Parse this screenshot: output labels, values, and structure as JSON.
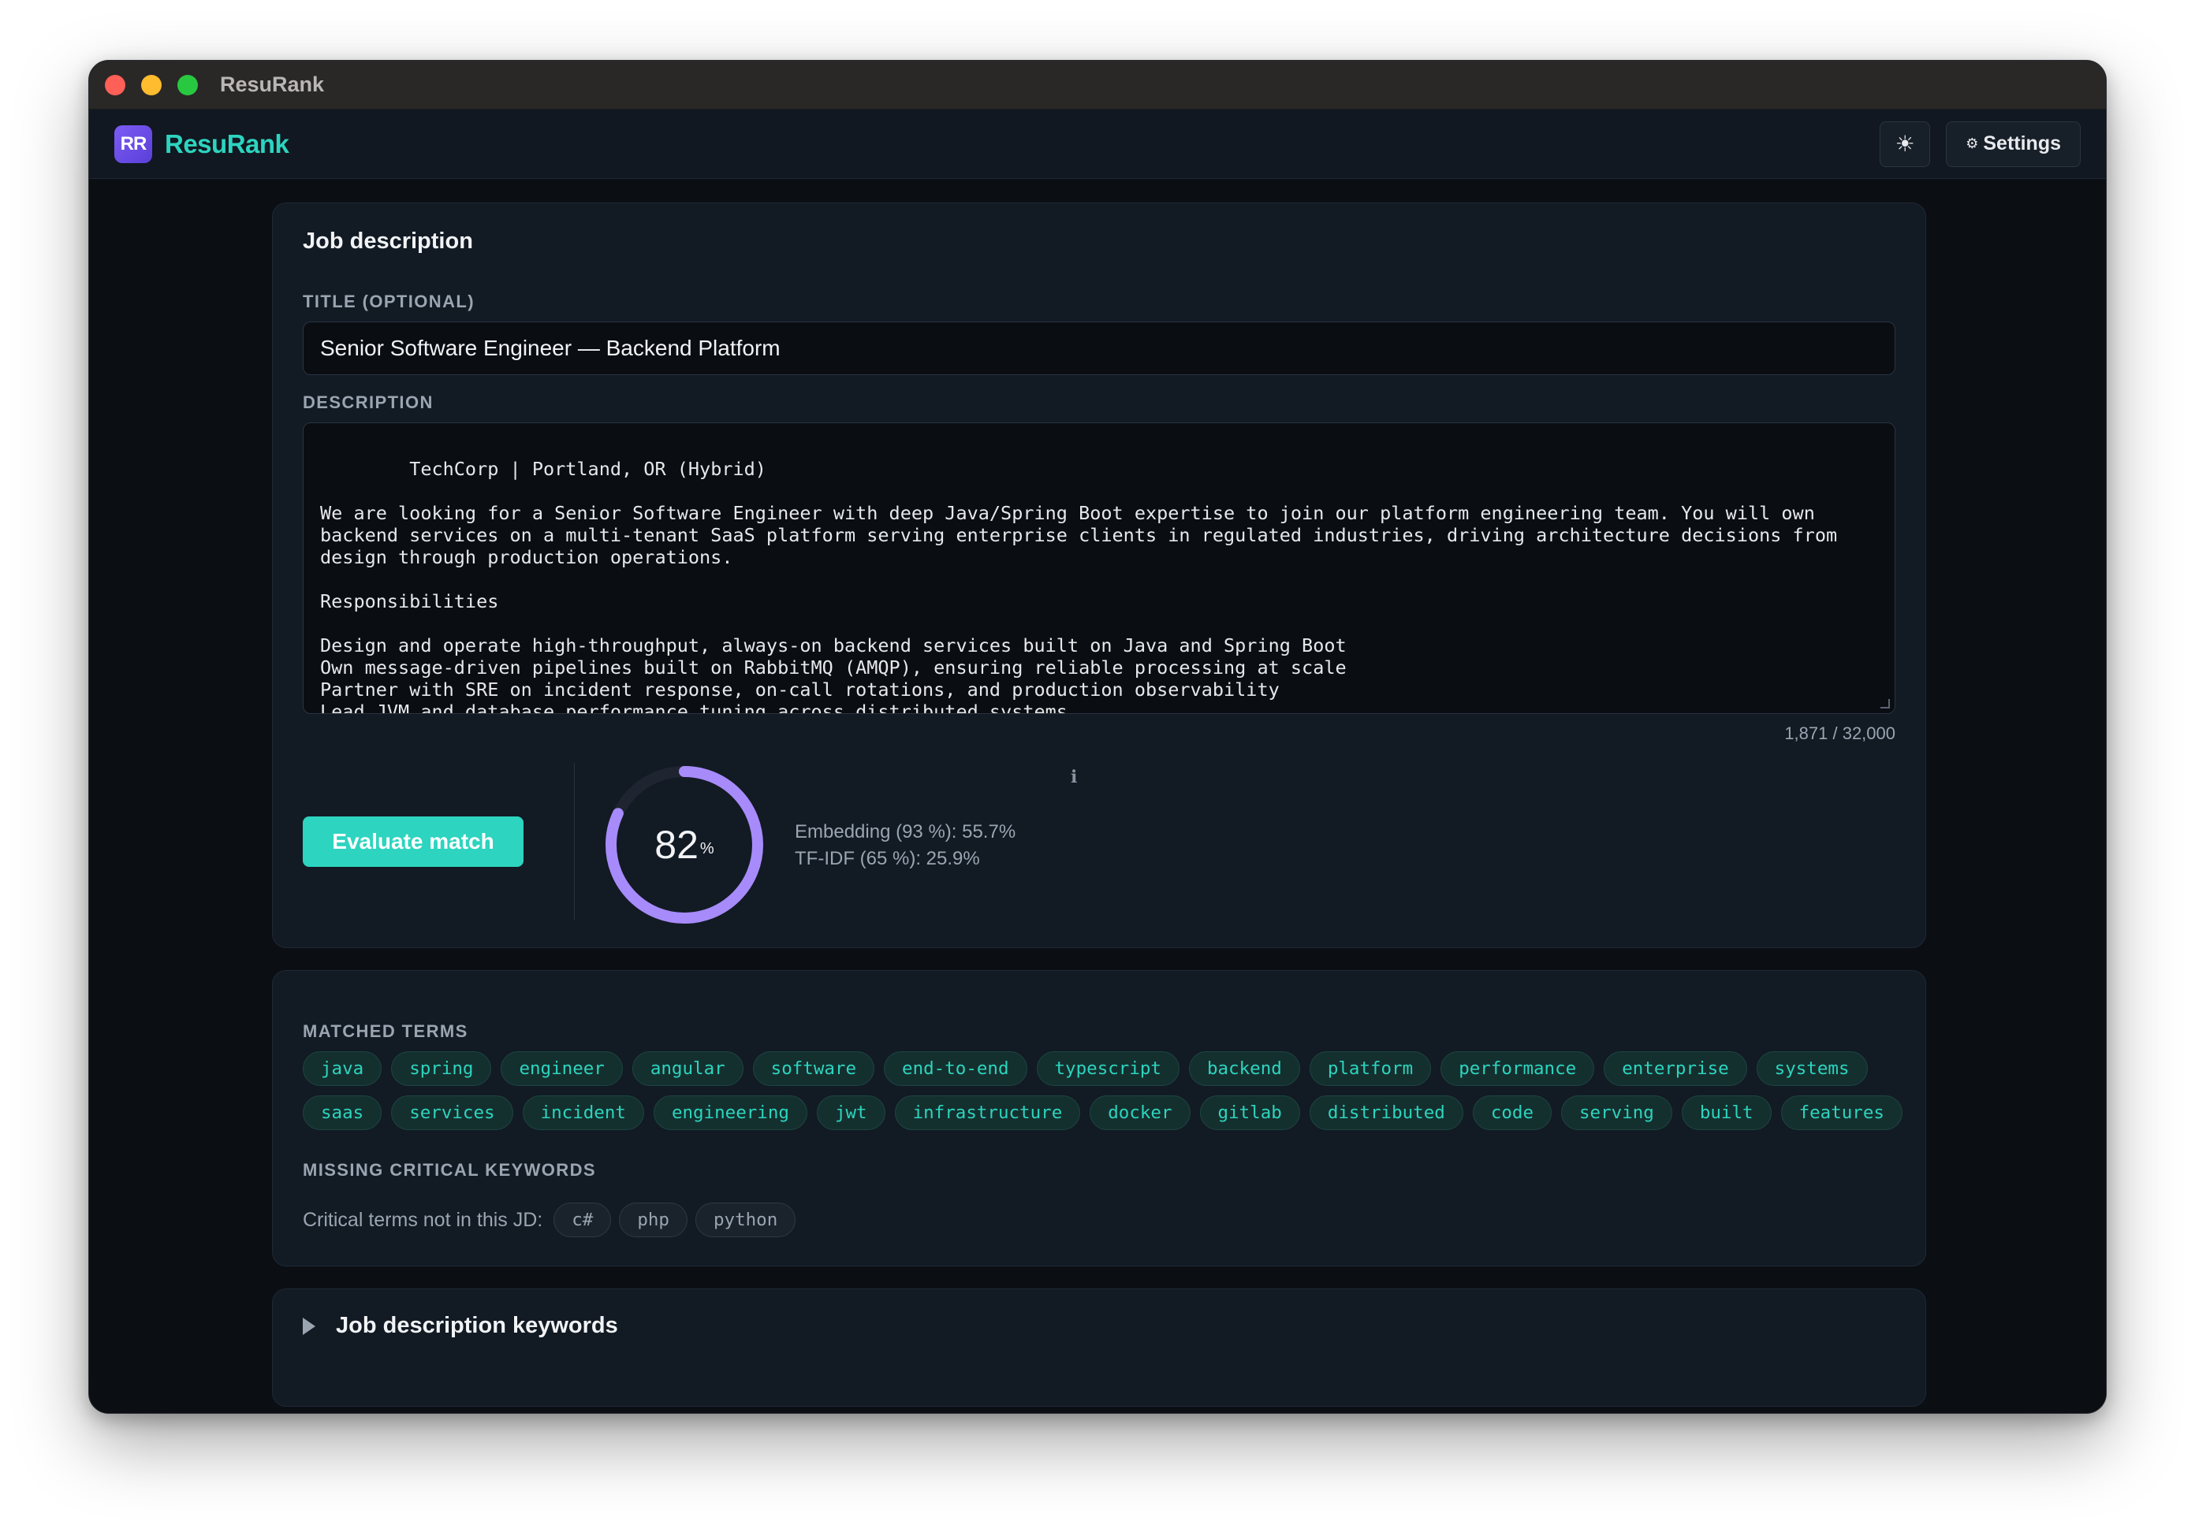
{
  "window": {
    "title": "ResuRank"
  },
  "header": {
    "logo_text": "RR",
    "brand": "ResuRank",
    "theme_icon": "☀",
    "settings_icon": "⚙",
    "settings_label": "Settings"
  },
  "job": {
    "section_title": "Job description",
    "title_label": "TITLE (OPTIONAL)",
    "title_value": "Senior Software Engineer — Backend Platform",
    "description_label": "DESCRIPTION",
    "description_value": "TechCorp | Portland, OR (Hybrid)\n\nWe are looking for a Senior Software Engineer with deep Java/Spring Boot expertise to join our platform engineering team. You will own backend services on a multi-tenant SaaS platform serving enterprise clients in regulated industries, driving architecture decisions from design through production operations.\n\nResponsibilities\n\nDesign and operate high-throughput, always-on backend services built on Java and Spring Boot\nOwn message-driven pipelines built on RabbitMQ (AMQP), ensuring reliable processing at scale\nPartner with SRE on incident response, on-call rotations, and production observability\nLead JVM and database performance tuning across distributed systems\nDrive CI/CD pipeline improvements using GitLab CI/CD and GitHub Actions",
    "char_count": "1,871 / 32,000"
  },
  "evaluation": {
    "button_label": "Evaluate match",
    "score": 82,
    "score_display": "82",
    "score_unit": "%",
    "info_icon": "ℹ",
    "embedding_text": "Embedding (93 %): 55.7%",
    "tfidf_text": "TF-IDF (65 %): 25.9%",
    "accent_color": "#a78bfa",
    "track_color": "#1f2530"
  },
  "terms": {
    "matched_label": "MATCHED TERMS",
    "matched": [
      [
        "java",
        "spring",
        "engineer",
        "angular",
        "software",
        "end-to-end",
        "typescript",
        "backend",
        "platform",
        "performance",
        "enterprise",
        "systems"
      ],
      [
        "saas",
        "services",
        "incident",
        "engineering",
        "jwt",
        "infrastructure",
        "docker",
        "gitlab",
        "distributed",
        "code",
        "serving",
        "built",
        "features"
      ]
    ],
    "missing_label": "MISSING CRITICAL KEYWORDS",
    "missing_text": "Critical terms not in this JD:",
    "missing": [
      "c#",
      "php",
      "python"
    ]
  },
  "keywords_section": {
    "label": "Job description keywords"
  },
  "colors": {
    "brand": "#2dd4bf",
    "chip_bg": "#14302e",
    "background": "#0b0f14",
    "card": "#121a24"
  }
}
